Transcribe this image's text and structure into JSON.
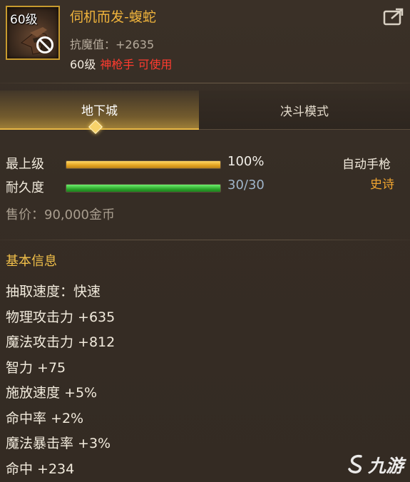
{
  "item": {
    "level_badge": "60级",
    "title": "伺机而发-蝮蛇",
    "resist": "抗魔值：+2635",
    "req_level": "60级",
    "req_class": "神枪手 可使用"
  },
  "tabs": [
    {
      "label": "地下城",
      "active": true
    },
    {
      "label": "决斗模式",
      "active": false
    }
  ],
  "stats": {
    "grade": {
      "label": "最上级",
      "value": "100%",
      "fill": 1.0
    },
    "durability": {
      "label": "耐久度",
      "value": "30/30",
      "fill": 1.0
    }
  },
  "weapon_type": "自动手枪",
  "rarity": "史诗",
  "price": "售价：90,000金币",
  "basic_info": {
    "title": "基本信息",
    "attributes": [
      "抽取速度：快速",
      "物理攻击力 +635",
      "魔法攻击力 +812",
      "智力 +75",
      "施放速度 +5%",
      "命中率 +2%",
      "魔法暴击率 +3%",
      "命中 +234"
    ]
  },
  "watermark": {
    "text": "九游"
  },
  "colors": {
    "title_gold": "#f0b43c",
    "class_red": "#ff3b2f",
    "rarity_orange": "#f0a430",
    "bar_gold": "#e2a21f",
    "bar_green": "#2ea82c"
  },
  "icons": [
    "forbidden-icon",
    "share-icon",
    "gun-icon",
    "tab-indicator-icon",
    "jiuyou-logo-icon"
  ]
}
